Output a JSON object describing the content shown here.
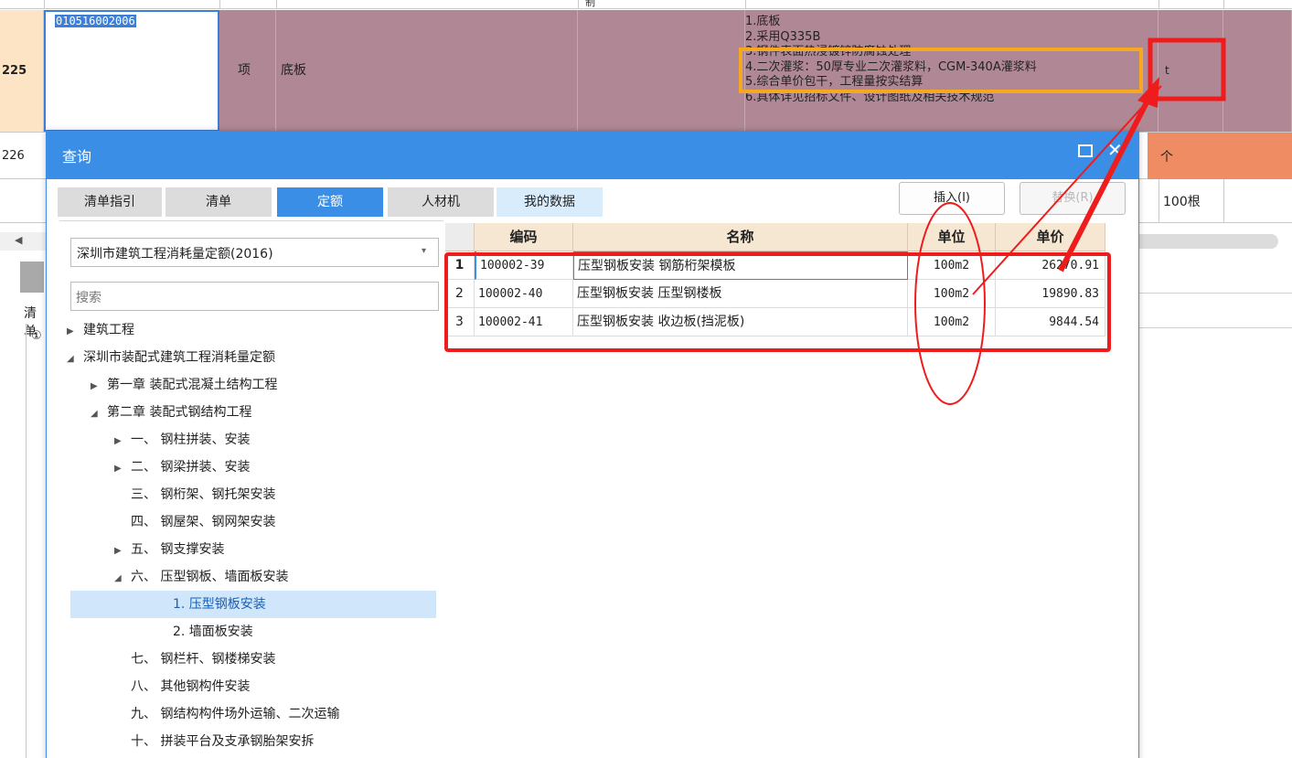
{
  "background": {
    "top_fragment": "制",
    "row225": {
      "number": "225",
      "code": "010516002006",
      "type": "项",
      "name": "底板",
      "features": [
        "1.底板",
        "2.采用Q335B",
        "3.钢件表面热浸镀锌防腐蚀处理",
        "4.二次灌浆：50厚专业二次灌浆料，CGM-340A灌浆料",
        "5.综合单价包干，工程量按实结算",
        "6.具体详见招标文件、设计图纸及相关技术规范"
      ],
      "unit": "t"
    },
    "row226": {
      "number": "226",
      "unit": "个"
    },
    "row227": {
      "unit": "100根"
    },
    "left_label": "清单",
    "left_circle": "①"
  },
  "dialog": {
    "title": "查询",
    "tabs": [
      {
        "label": "清单指引"
      },
      {
        "label": "清单"
      },
      {
        "label": "定额"
      },
      {
        "label": "人材机"
      },
      {
        "label": "我的数据"
      }
    ],
    "insert_button": "插入(I)",
    "replace_button": "替换(R)",
    "library_select": "深圳市建筑工程消耗量定额(2016)",
    "search_placeholder": "搜索",
    "tree": [
      "建筑工程",
      "深圳市装配式建筑工程消耗量定额",
      "第一章 装配式混凝土结构工程",
      "第二章 装配式钢结构工程",
      "一、 钢柱拼装、安装",
      "二、 钢梁拼装、安装",
      "三、 钢桁架、钢托架安装",
      "四、 钢屋架、钢网架安装",
      "五、 钢支撑安装",
      "六、 压型钢板、墙面板安装",
      "1. 压型钢板安装",
      "2. 墙面板安装",
      "七、 钢栏杆、钢楼梯安装",
      "八、 其他钢构件安装",
      "九、 钢结构构件场外运输、二次运输",
      "十、 拼装平台及支承钢胎架安拆"
    ],
    "table": {
      "headers": [
        "编码",
        "名称",
        "单位",
        "单价"
      ],
      "rows": [
        {
          "no": "1",
          "code": "100002-39",
          "name": "压型钢板安装 钢筋桁架模板",
          "unit": "100m2",
          "price": "26270.91"
        },
        {
          "no": "2",
          "code": "100002-40",
          "name": "压型钢板安装 压型钢楼板",
          "unit": "100m2",
          "price": "19890.83"
        },
        {
          "no": "3",
          "code": "100002-41",
          "name": "压型钢板安装 收边板(挡泥板)",
          "unit": "100m2",
          "price": "9844.54"
        }
      ]
    }
  },
  "colors": {
    "accent": "#3a8ee6",
    "row_highlight": "#b08895",
    "orange_cell": "#f08c63",
    "annotation_red": "#ee1c1c",
    "annotation_orange": "#f6a821"
  }
}
